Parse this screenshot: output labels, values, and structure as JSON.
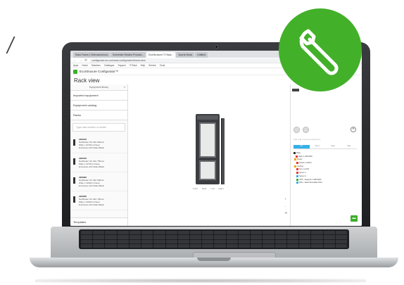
{
  "browser": {
    "tabs": [
      "Rack Frame | Oberwandmont...",
      "Schneider Electric Product...",
      "EcoStruxure IT Rack...",
      "Sports News",
      "Untitled"
    ],
    "url": "configurator.se.com/rack-configurator/#/rack-view",
    "bookmarks": [
      "Apps",
      "Home",
      "Solutions",
      "Catalogue",
      "Support",
      "IT Rack",
      "Help",
      "Service",
      "Tools"
    ]
  },
  "app": {
    "title": "EcoStruxure Configurator™",
    "page_title": "Rack view"
  },
  "left_panel": {
    "header": "Equipment library",
    "rows": [
      "Imported equipment",
      "Equipment catalog",
      "Racks"
    ],
    "search_placeholder": "Type rack number or model",
    "products": [
      {
        "code": "AR3100",
        "lines": [
          "NetShelter SX 42U 600mm",
          "Wide x 1070mm Deep",
          "Enclosure with Sides Black"
        ]
      },
      {
        "code": "AR3150",
        "lines": [
          "NetShelter SX 42U 750mm",
          "Wide x 1070mm Deep",
          "Enclosure with Sides Black"
        ]
      },
      {
        "code": "AR3300",
        "lines": [
          "NetShelter SX 42U 600mm",
          "Wide x 1200mm Deep",
          "Enclosure with Sides Black"
        ]
      },
      {
        "code": "AR3350",
        "lines": [
          "NetShelter SX 42U 750mm",
          "Wide x 1200mm Deep",
          "Enclosure with Sides Black"
        ]
      }
    ],
    "footer": "Templates"
  },
  "canvas": {
    "legend": [
      "Front",
      "Rear",
      "Left",
      "Right"
    ],
    "tools": [
      "+",
      "-",
      "⟲"
    ]
  },
  "right_panel": {
    "hint": "Add, edit or remove equipment",
    "tabs": [
      "List",
      "Front",
      "Rear",
      "Side"
    ],
    "tree": [
      "Rack",
      "Rack 1 (AR3100)",
      "Power",
      "Switch 1 (SMT)",
      "Cooling",
      "Fan 1 (ACF)",
      "Server 1",
      "Server 2",
      "UPS - Network 1 SMT3000",
      "PDU - Rack Mountable PDU"
    ],
    "tree_colors": [
      "#333333",
      "#e53935",
      "#f4a300",
      "#e53935",
      "#f4a300",
      "#e53935",
      "#e53935",
      "#35b0e8",
      "#3dae2b",
      "#35b0e8"
    ]
  },
  "badge": {
    "icon": "wrench-icon",
    "color": "#43b02a"
  }
}
